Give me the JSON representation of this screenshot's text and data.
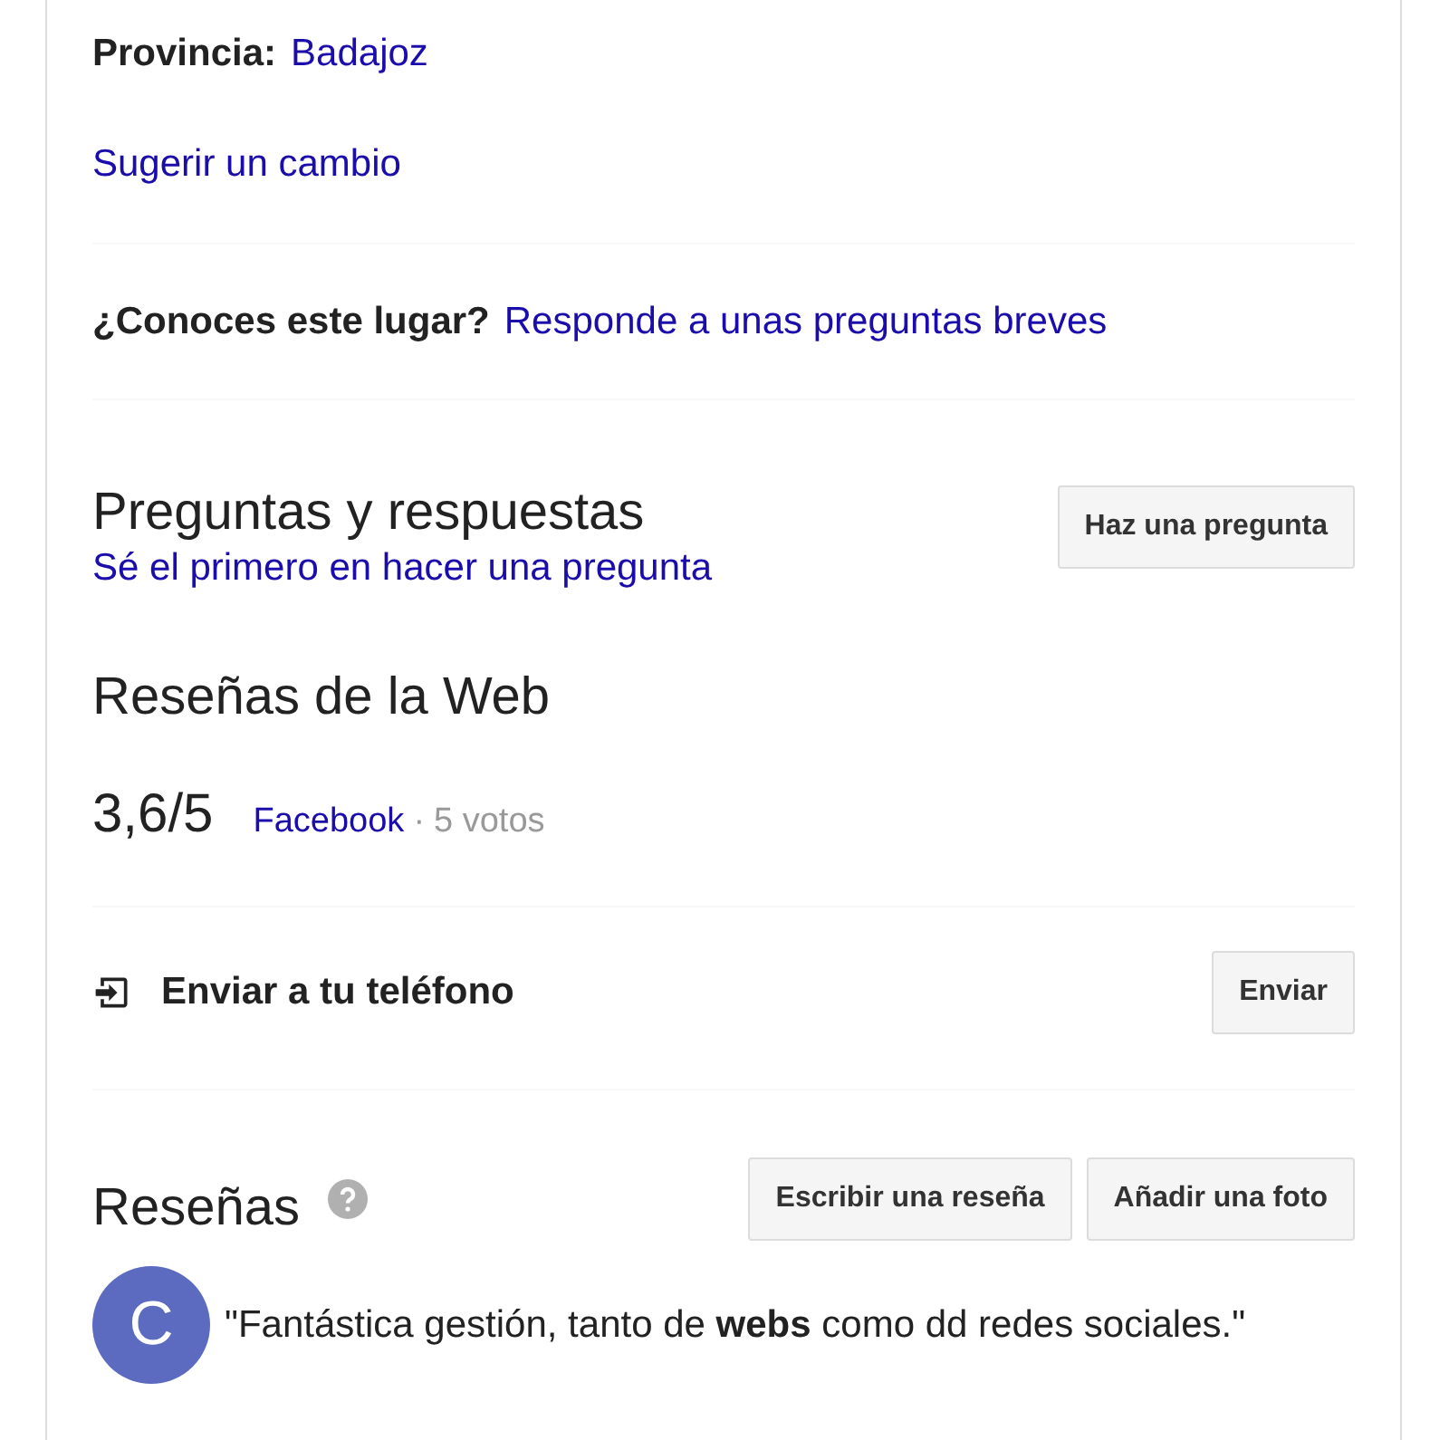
{
  "province": {
    "label": "Provincia:",
    "value": "Badajoz"
  },
  "suggest_link": "Sugerir un cambio",
  "know_place": {
    "question": "¿Conoces este lugar?",
    "link": "Responde a unas preguntas breves"
  },
  "qa": {
    "title": "Preguntas y respuestas",
    "link": "Sé el primero en hacer una pregunta",
    "button": "Haz una pregunta"
  },
  "web_reviews": {
    "title": "Reseñas de la Web",
    "rating": "3,6/5",
    "source": "Facebook",
    "separator": "·",
    "votes": "5 votos"
  },
  "send_to_phone": {
    "label": "Enviar a tu teléfono",
    "button": "Enviar"
  },
  "reviews": {
    "title": "Reseñas",
    "buttons": [
      "Escribir una reseña",
      "Añadir una foto"
    ],
    "items": [
      {
        "avatar_letter": "C",
        "color": "#5c6bc0",
        "text": "\"Fantástica gestión, tanto de **webs** como dd redes sociales.\""
      }
    ]
  }
}
